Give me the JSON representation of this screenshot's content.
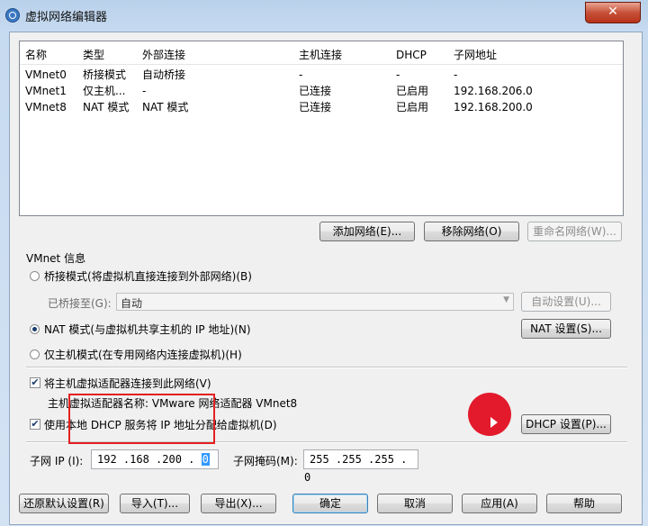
{
  "window": {
    "title": "虚拟网络编辑器",
    "close_label": "✕"
  },
  "network_list": {
    "columns": [
      "名称",
      "类型",
      "外部连接",
      "主机连接",
      "DHCP",
      "子网地址"
    ],
    "rows": [
      [
        "VMnet0",
        "桥接模式",
        "自动桥接",
        "-",
        "-",
        "-"
      ],
      [
        "VMnet1",
        "仅主机...",
        "-",
        "已连接",
        "已启用",
        "192.168.206.0"
      ],
      [
        "VMnet8",
        "NAT 模式",
        "NAT 模式",
        "已连接",
        "已启用",
        "192.168.200.0"
      ]
    ]
  },
  "list_buttons": {
    "add_network": "添加网络(E)...",
    "remove_network": "移除网络(O)",
    "rename_network": "重命名网络(W)..."
  },
  "vmnet_info": {
    "group_label": "VMnet 信息",
    "bridged_label": "桥接模式(将虚拟机直接连接到外部网络)(B)",
    "bridged_to_label": "已桥接至(G):",
    "bridged_to_value": "自动",
    "auto_settings_button": "自动设置(U)...",
    "nat_label": "NAT 模式(与虚拟机共享主机的 IP 地址)(N)",
    "nat_settings_button": "NAT 设置(S)...",
    "hostonly_label": "仅主机模式(在专用网络内连接虚拟机)(H)",
    "selected_mode": "nat",
    "connect_adapter_label": "将主机虚拟适配器连接到此网络(V)",
    "connect_adapter_checked": true,
    "adapter_name_label": "主机虚拟适配器名称: VMware 网络适配器 VMnet8",
    "dhcp_label": "使用本地 DHCP 服务将 IP 地址分配给虚拟机(D)",
    "dhcp_checked": true,
    "dhcp_settings_button": "DHCP 设置(P)...",
    "subnet_ip_label": "子网 IP (I):",
    "subnet_ip_prefix": "192 .168 .200 .",
    "subnet_ip_last": "0",
    "subnet_mask_label": "子网掩码(M):",
    "subnet_mask_value": "255 .255 .255 . 0"
  },
  "footer_buttons": {
    "restore_defaults": "还原默认设置(R)",
    "import": "导入(T)...",
    "export": "导出(X)...",
    "ok": "确定",
    "cancel": "取消",
    "apply": "应用(A)",
    "help": "帮助"
  },
  "colors": {
    "selection": "#3399ff",
    "annotation": "#e32020",
    "cursor": "#e31a2b"
  }
}
